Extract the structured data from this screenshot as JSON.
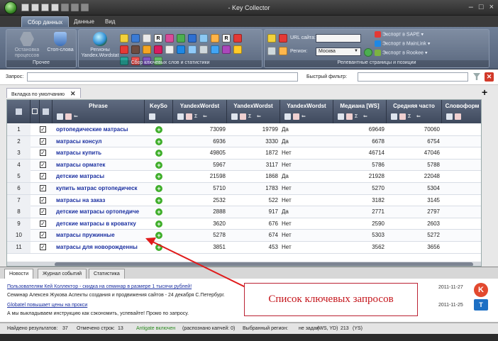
{
  "window": {
    "title": "- Key Collector"
  },
  "tabs": [
    {
      "label": "Сбор данных"
    },
    {
      "label": "Данные"
    },
    {
      "label": "Вид"
    }
  ],
  "ribbon": {
    "group_other": {
      "caption": "Прочее",
      "stop_label": "Остановка процессов",
      "stopwords_label": "Стоп-слова"
    },
    "group_collect": {
      "caption": "Сбор ключевых слов и статистики",
      "regions_label": "Регионы Yandex.Wordstat"
    },
    "group_pages": {
      "caption": "Релевантные страницы и позиции",
      "url_label": "URL сайта:",
      "url_value": "",
      "region_label": "Регион:",
      "region_value": "Москва"
    },
    "exports": [
      "Экспорт в SAPE",
      "Экспорт в MainLink",
      "Экспорт в Rookee"
    ]
  },
  "search": {
    "query_label": "Запрос:",
    "quick_filter_label": "Быстрый фильтр:"
  },
  "doc_tab": {
    "label": "Вкладка по умолчанию"
  },
  "table": {
    "columns": [
      "Phrase",
      "KeySo",
      "YandexWordst",
      "YandexWordst",
      "YandexWordst",
      "Медиана [WS]",
      "Средняя часто",
      "Словоформ"
    ],
    "rows": [
      {
        "n": "1",
        "phrase": "ортопедические матрасы",
        "v1": "73099",
        "v2": "19799",
        "v3": "Да",
        "v4": "69649",
        "v5": "70060"
      },
      {
        "n": "2",
        "phrase": "матрасы консул",
        "v1": "6936",
        "v2": "3330",
        "v3": "Да",
        "v4": "6678",
        "v5": "6754"
      },
      {
        "n": "3",
        "phrase": "матрасы купить",
        "v1": "49805",
        "v2": "1872",
        "v3": "Нет",
        "v4": "46714",
        "v5": "47046"
      },
      {
        "n": "4",
        "phrase": "матрасы орматек",
        "v1": "5967",
        "v2": "3117",
        "v3": "Нет",
        "v4": "5786",
        "v5": "5788"
      },
      {
        "n": "5",
        "phrase": "детские матрасы",
        "v1": "21598",
        "v2": "1868",
        "v3": "Да",
        "v4": "21928",
        "v5": "22048"
      },
      {
        "n": "6",
        "phrase": "купить матрас ортопедическ",
        "v1": "5710",
        "v2": "1783",
        "v3": "Нет",
        "v4": "5270",
        "v5": "5304"
      },
      {
        "n": "7",
        "phrase": "матрасы на заказ",
        "v1": "2532",
        "v2": "522",
        "v3": "Нет",
        "v4": "3182",
        "v5": "3145"
      },
      {
        "n": "8",
        "phrase": "детские матрасы ортопедиче",
        "v1": "2888",
        "v2": "917",
        "v3": "Да",
        "v4": "2771",
        "v5": "2797"
      },
      {
        "n": "9",
        "phrase": "детские матрасы в кроватку",
        "v1": "3620",
        "v2": "676",
        "v3": "Нет",
        "v4": "2590",
        "v5": "2603"
      },
      {
        "n": "10",
        "phrase": "матрасы пружинные",
        "v1": "5278",
        "v2": "674",
        "v3": "Нет",
        "v4": "5303",
        "v5": "5272"
      },
      {
        "n": "11",
        "phrase": "матрасы для новорожденны",
        "v1": "3851",
        "v2": "453",
        "v3": "Нет",
        "v4": "3562",
        "v5": "3656"
      }
    ]
  },
  "bottom_tabs": [
    {
      "label": "Новости"
    },
    {
      "label": "Журнал событий"
    },
    {
      "label": "Статистика"
    }
  ],
  "news": [
    {
      "text": "Пользователям Кей Коллектор - скидка на семинар в размере 1 тысячи рублей!",
      "link": true,
      "date": "2011-11-27"
    },
    {
      "text": "Семинар Алексея Жукова Аспекты создания и продвижения сайтов - 24 декабря С.Петербург.",
      "link": false,
      "date": ""
    },
    {
      "text": "Globatel повышает цены на прокси",
      "link": true,
      "date": "2011-11-25"
    },
    {
      "text": "А мы выкладываем инструкцию как сэкономить, успевайте! Промо по запросу.",
      "link": false,
      "date": ""
    }
  ],
  "status": {
    "found_label": "Найдено результатов:",
    "found_value": "37",
    "marked_label": "Отмечено строк:",
    "marked_value": "13",
    "antigate": "Antigate включен",
    "captcha": "(распознано капчей: 0)",
    "region_label": "Выбранный регион:",
    "region_value": "не задан",
    "ws_yd": "(WS, YD)",
    "num": "213",
    "ys": "(YS)"
  },
  "annotation": {
    "text": "Список ключевых запросов"
  },
  "colors": {
    "annotation": "#c4141a",
    "link": "#1a2fa0",
    "ribbon": "#6f7f97"
  }
}
